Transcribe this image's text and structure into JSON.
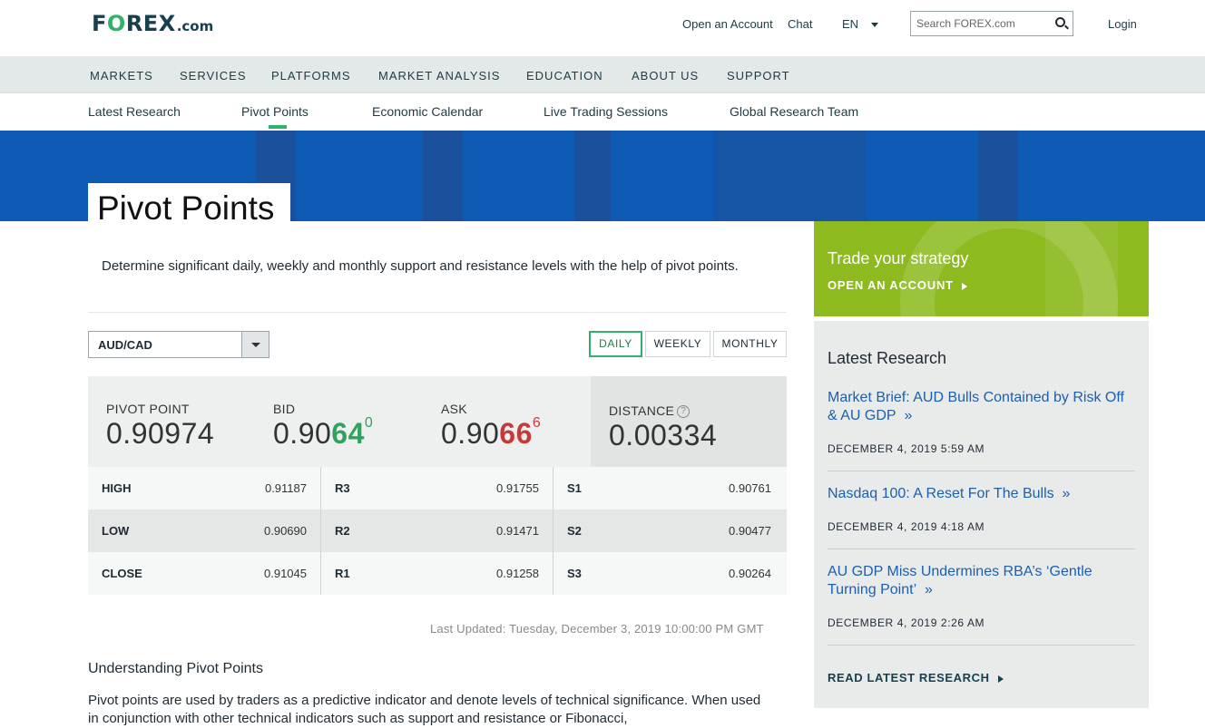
{
  "header": {
    "logo": {
      "f": "F",
      "o": "O",
      "rex": "REX",
      "dotcom": ".com"
    },
    "open_account": "Open an Account",
    "chat": "Chat",
    "language": "EN",
    "search_placeholder": "Search FOREX.com",
    "login": "Login"
  },
  "main_nav": [
    "MARKETS",
    "SERVICES",
    "PLATFORMS",
    "MARKET ANALYSIS",
    "EDUCATION",
    "ABOUT US",
    "SUPPORT"
  ],
  "sub_nav": {
    "items": [
      "Latest Research",
      "Pivot Points",
      "Economic Calendar",
      "Live Trading Sessions",
      "Global Research Team"
    ],
    "active": "Pivot Points"
  },
  "page": {
    "title": "Pivot Points",
    "intro": "Determine significant daily, weekly and monthly support and resistance levels with the help of pivot points."
  },
  "tool": {
    "pair": "AUD/CAD",
    "timeframes": [
      "DAILY",
      "WEEKLY",
      "MONTHLY"
    ],
    "active_timeframe": "DAILY",
    "quote": {
      "pivot_label": "PIVOT POINT",
      "pivot_value": "0.90974",
      "bid_label": "BID",
      "bid_prefix": "0.90",
      "bid_big": "64",
      "bid_pip": "0",
      "ask_label": "ASK",
      "ask_prefix": "0.90",
      "ask_big": "66",
      "ask_pip": "6",
      "distance_label": "DISTANCE",
      "distance_value": "0.00334",
      "help_glyph": "?"
    },
    "levels": [
      [
        {
          "name": "HIGH",
          "value": "0.91187"
        },
        {
          "name": "R3",
          "value": "0.91755"
        },
        {
          "name": "S1",
          "value": "0.90761"
        }
      ],
      [
        {
          "name": "LOW",
          "value": "0.90690"
        },
        {
          "name": "R2",
          "value": "0.91471"
        },
        {
          "name": "S2",
          "value": "0.90477"
        }
      ],
      [
        {
          "name": "CLOSE",
          "value": "0.91045"
        },
        {
          "name": "R1",
          "value": "0.91258"
        },
        {
          "name": "S3",
          "value": "0.90264"
        }
      ]
    ],
    "last_updated_label": "Last Updated:",
    "last_updated_value": "Tuesday, December 3, 2019 10:00:00 PM GMT"
  },
  "understanding": {
    "title": "Understanding Pivot Points",
    "body": "Pivot points are used by traders as a predictive indicator and denote levels of technical significance. When used in conjunction with other technical indicators such as support and resistance or Fibonacci,"
  },
  "promo": {
    "title": "Trade your strategy",
    "cta": "OPEN AN ACCOUNT"
  },
  "research": {
    "title": "Latest Research",
    "items": [
      {
        "title": "Market Brief: AUD Bulls Contained by Risk Off & AU GDP",
        "date": "DECEMBER 4, 2019 5:59 AM"
      },
      {
        "title": "Nasdaq 100: A Reset For The Bulls",
        "date": "DECEMBER 4, 2019 4:18 AM"
      },
      {
        "title": "AU GDP Miss Undermines RBA’s ‘Gentle Turning Point’",
        "date": "DECEMBER 4, 2019 2:26 AM"
      }
    ],
    "more_glyph": "»",
    "cta": "READ LATEST RESEARCH"
  },
  "colors": {
    "brand_green": "#2fb36a",
    "hero_blue": "#0e5bb5",
    "promo_green": "#8dba1f",
    "bid_green": "#2fa35c",
    "ask_red": "#c83a3a",
    "link_blue": "#1b5fae"
  }
}
